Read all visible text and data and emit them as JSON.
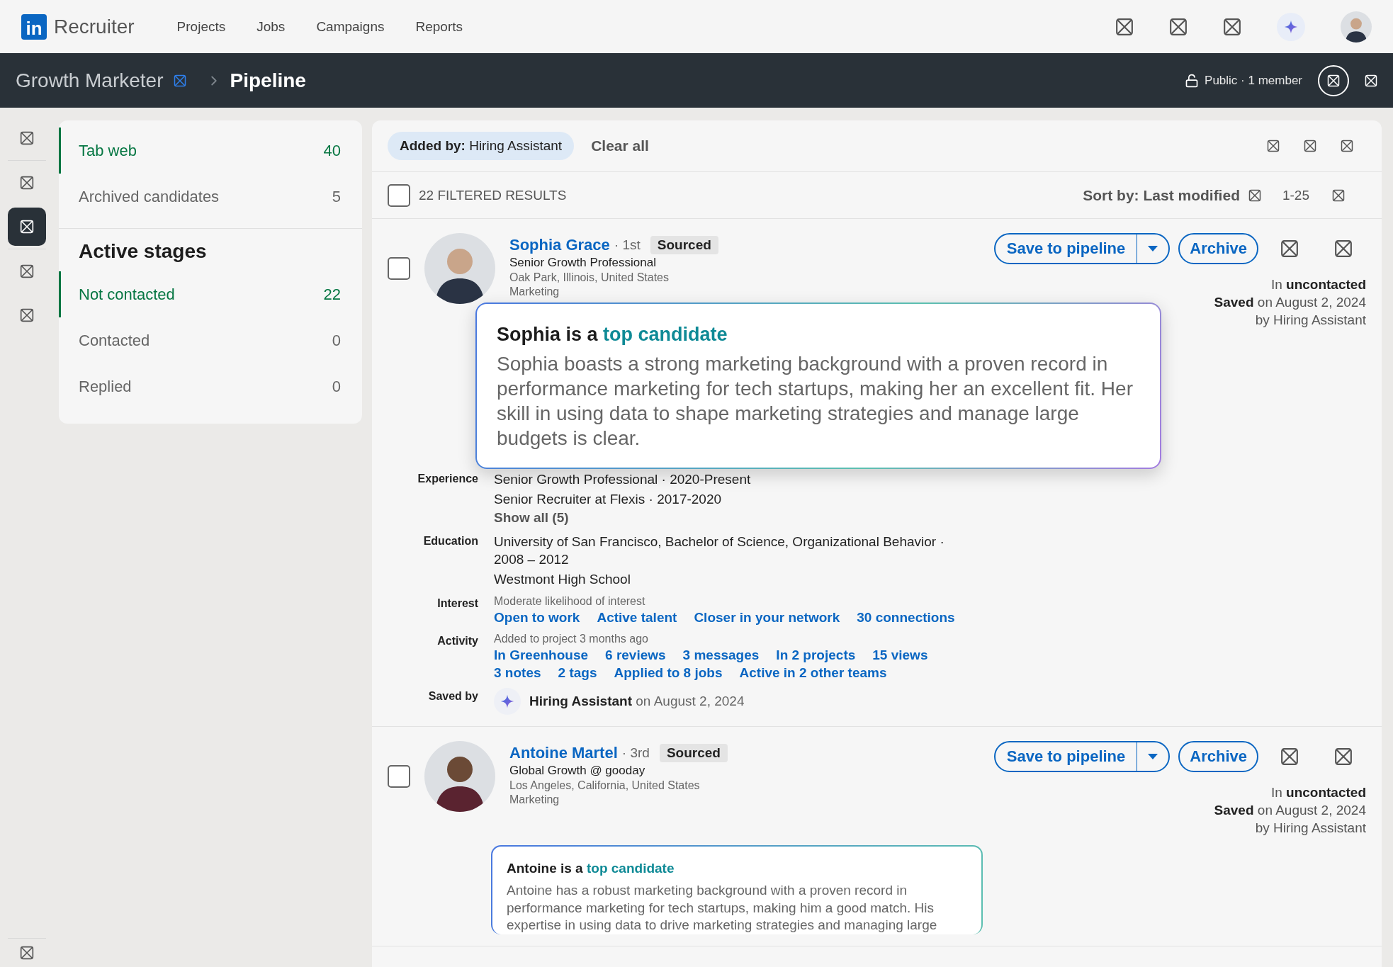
{
  "top_nav": {
    "logo_mark": "in",
    "product": "Recruiter",
    "links": [
      {
        "label": "Projects"
      },
      {
        "label": "Jobs"
      },
      {
        "label": "Campaigns"
      },
      {
        "label": "Reports"
      }
    ]
  },
  "project_bar": {
    "title": "Growth Marketer",
    "current": "Pipeline",
    "visibility": "Public · 1 member"
  },
  "rail": {
    "items": [
      {
        "selected": false
      },
      {
        "selected": false
      },
      {
        "selected": true
      },
      {
        "selected": false
      },
      {
        "selected": false
      }
    ]
  },
  "sidebar": {
    "tabs": [
      {
        "label": "Tab web",
        "count": "40",
        "selected": true
      },
      {
        "label": "Archived candidates",
        "count": "5",
        "selected": false
      }
    ],
    "section_title": "Active stages",
    "stages": [
      {
        "label": "Not contacted",
        "count": "22",
        "selected": true
      },
      {
        "label": "Contacted",
        "count": "0",
        "selected": false
      },
      {
        "label": "Replied",
        "count": "0",
        "selected": false
      }
    ]
  },
  "filters": {
    "chip": "**Added by:** Hiring Assistant",
    "clear": "Clear all"
  },
  "results": {
    "checked": false,
    "count_label": "22 FILTERED RESULTS",
    "sort": "Sort by: Last modified",
    "range": "1-25"
  },
  "candidates": [
    {
      "name": "Sophia Grace",
      "degree": "· 1st",
      "tag": "Sourced",
      "headline": "Senior Growth Professional",
      "location": "Oak Park, Illinois, United States",
      "industry": "Marketing",
      "checked": false,
      "save": "Save to pipeline",
      "archive": "Archive",
      "stage": "In **uncontacted**",
      "saved": "**Saved** on August 2, 2024",
      "saved_by": "by Hiring Assistant",
      "summary": {
        "kind": "popover",
        "lead": "Sophia is a",
        "highlight": "top candidate",
        "body": "Sophia boasts a strong marketing background with a proven record in performance marketing for tech startups, making her an excellent fit. Her skill in using data to shape marketing strategies and manage large budgets is clear."
      },
      "details": [
        {
          "label": "Experience",
          "lines": [
            {
              "kind": "text",
              "text": "Senior Growth Professional · 2020-Present"
            },
            {
              "kind": "text",
              "text": "Senior Recruiter at Flexis · 2017-2020"
            },
            {
              "kind": "more",
              "text": "Show all (5)"
            }
          ]
        },
        {
          "label": "Education",
          "lines": [
            {
              "kind": "text",
              "text": "University of San Francisco, Bachelor of Science, Organizational Behavior · 2008 – 2012"
            },
            {
              "kind": "text",
              "text": "Westmont High School"
            }
          ]
        },
        {
          "label": "Interest",
          "lines": [
            {
              "kind": "note",
              "text": "Moderate likelihood of interest"
            },
            {
              "kind": "links",
              "links": [
                "Open to work",
                "Active talent",
                "Closer in your network",
                "30 connections"
              ]
            }
          ]
        },
        {
          "label": "Activity",
          "lines": [
            {
              "kind": "note",
              "text": "Added to project 3 months ago"
            },
            {
              "kind": "links",
              "links": [
                "In Greenhouse",
                "6 reviews",
                "3 messages",
                "In 2 projects",
                "15 views"
              ]
            },
            {
              "kind": "links",
              "links": [
                "3 notes",
                "2 tags",
                "Applied to 8 jobs",
                "Active in 2 other teams"
              ]
            }
          ]
        },
        {
          "label": "Saved by",
          "lines": [
            {
              "kind": "saver",
              "text": "**Hiring Assistant** on August 2, 2024"
            }
          ]
        }
      ]
    },
    {
      "name": "Antoine Martel",
      "degree": "· 3rd",
      "tag": "Sourced",
      "headline": "Global Growth @ gooday",
      "location": "Los Angeles, California, United States",
      "industry": "Marketing",
      "checked": false,
      "save": "Save to pipeline",
      "archive": "Archive",
      "stage": "In **uncontacted**",
      "saved": "**Saved** on August 2, 2024",
      "saved_by": "by Hiring Assistant",
      "summary": {
        "kind": "inline",
        "lead": "Antoine is a",
        "highlight": "top candidate",
        "body": "Antoine has a robust marketing background with a proven record in performance marketing for tech startups, making him a good match. His expertise in using data to drive marketing strategies and managing large"
      }
    }
  ]
}
